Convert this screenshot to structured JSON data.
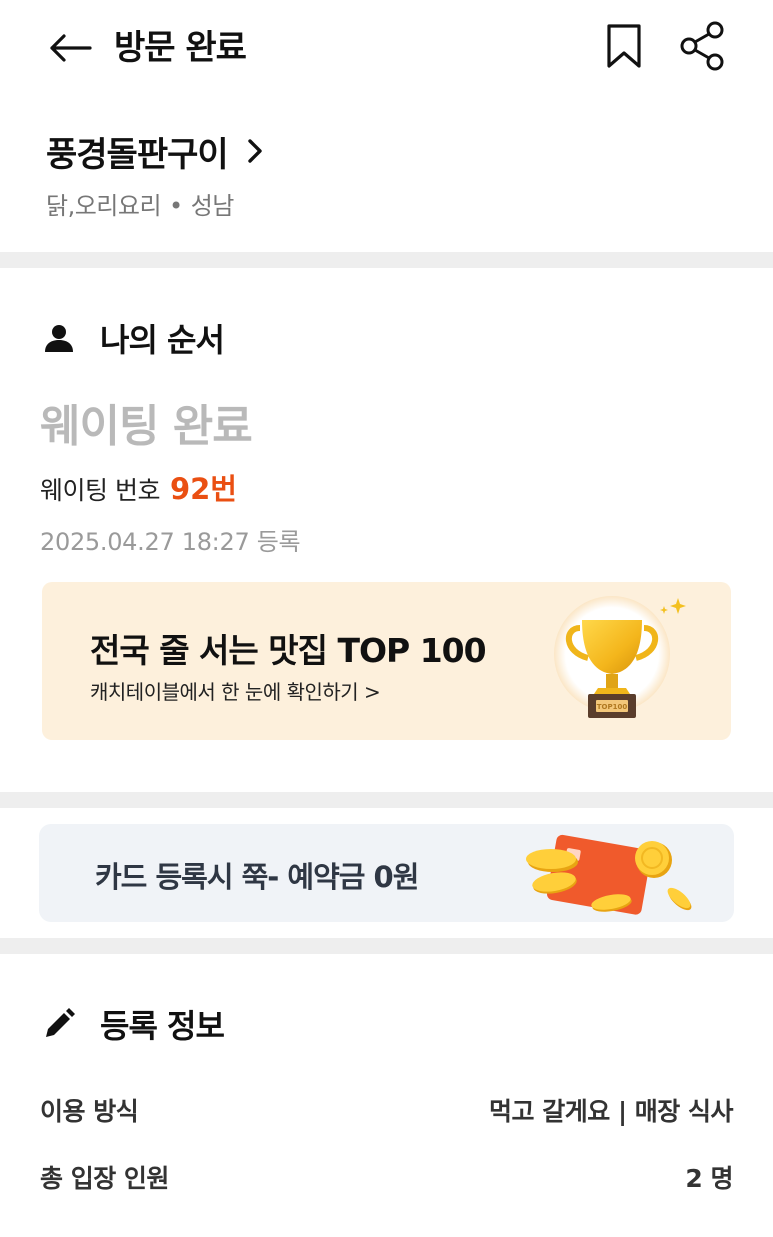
{
  "header": {
    "title": "방문 완료",
    "back_icon": "arrow-left-icon",
    "bookmark_icon": "bookmark-icon",
    "share_icon": "share-icon"
  },
  "store": {
    "name": "풍경돌판구이",
    "category": "닭,오리요리",
    "separator": "•",
    "location": "성남"
  },
  "my_order": {
    "section_title": "나의 순서",
    "section_icon": "person-icon",
    "status": "웨이팅 완료",
    "number_label": "웨이팅 번호",
    "number_value": "92번",
    "registered_at": "2025.04.27 18:27 등록"
  },
  "top_banner": {
    "title": "전국 줄 서는 맛집 TOP 100",
    "subtitle": "캐치테이블에서 한 눈에 확인하기 >",
    "icon": "trophy-icon",
    "trophy_plate": "TOP100",
    "background": "#fdf0dc"
  },
  "card_banner": {
    "title": "카드 등록시 쭉- 예약금 0원",
    "icon": "credit-card-coins-icon",
    "background": "#f0f3f7"
  },
  "registration": {
    "section_title": "등록 정보",
    "section_icon": "pencil-icon",
    "rows": [
      {
        "label": "이용 방식",
        "value": "먹고 갈게요 | 매장 식사"
      },
      {
        "label": "총 입장 인원",
        "value": "2 명"
      }
    ]
  },
  "colors": {
    "accent": "#ea4f12",
    "muted": "#9a9a9a",
    "divider": "#eeeeee"
  }
}
